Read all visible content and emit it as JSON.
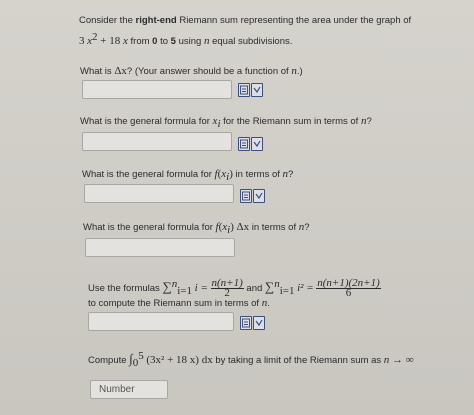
{
  "intro": {
    "line1_pre": "Consider the ",
    "line1_bold": "right-end",
    "line1_post": " Riemann sum representing the area under the graph of",
    "f_coef1": "3",
    "f_var1": "x",
    "f_exp": "2",
    "f_plus": " + 18 ",
    "f_var2": "x",
    "line2_mid": " from ",
    "from": "0",
    "to_word": " to ",
    "to": "5",
    "using": " using ",
    "n": "n",
    "post": " equal subdivisions."
  },
  "q1": {
    "pre": "What is ",
    "delta": "Δx",
    "post": "? (Your answer should be a function of ",
    "n": "n",
    "end": ".)"
  },
  "q2": {
    "pre": "What is the general formula for ",
    "xi": "x",
    "i": "i",
    "post": " for the Riemann sum in terms of ",
    "n": "n",
    "end": "?"
  },
  "q3": {
    "pre": "What is the general formula for ",
    "f": "f",
    "xi": "x",
    "i": "i",
    "post": " in terms of ",
    "n": "n",
    "end": "?"
  },
  "q4": {
    "pre": "What is the general formula for ",
    "f": "f",
    "xi": "x",
    "i": "i",
    "dx": "Δx",
    "post": " in terms of ",
    "n": "n",
    "end": "?"
  },
  "formulas": {
    "use": "Use the formulas ",
    "sum1_body": "i =",
    "sum1_num": "n(n+1)",
    "sum1_den": "2",
    "and": " and ",
    "sum2_body": "i² =",
    "sum2_num": "n(n+1)(2n+1)",
    "sum2_den": "6",
    "line2": "to compute the Riemann sum in terms of ",
    "n": "n",
    "end": "."
  },
  "compute": {
    "pre": "Compute ",
    "integral": "∫",
    "lower": "0",
    "upper": "5",
    "integrand": "(3x² + 18 x) dx",
    "post": " by taking a limit of the Riemann sum as ",
    "lim": "n → ∞"
  },
  "answer_boxes": {
    "delta_x": "",
    "x_i": "",
    "f_x_i": "",
    "f_x_i_delta_x": "",
    "riemann_sum": "",
    "integral_placeholder": "Number"
  },
  "icons": [
    "preview-icon",
    "help-icon"
  ]
}
